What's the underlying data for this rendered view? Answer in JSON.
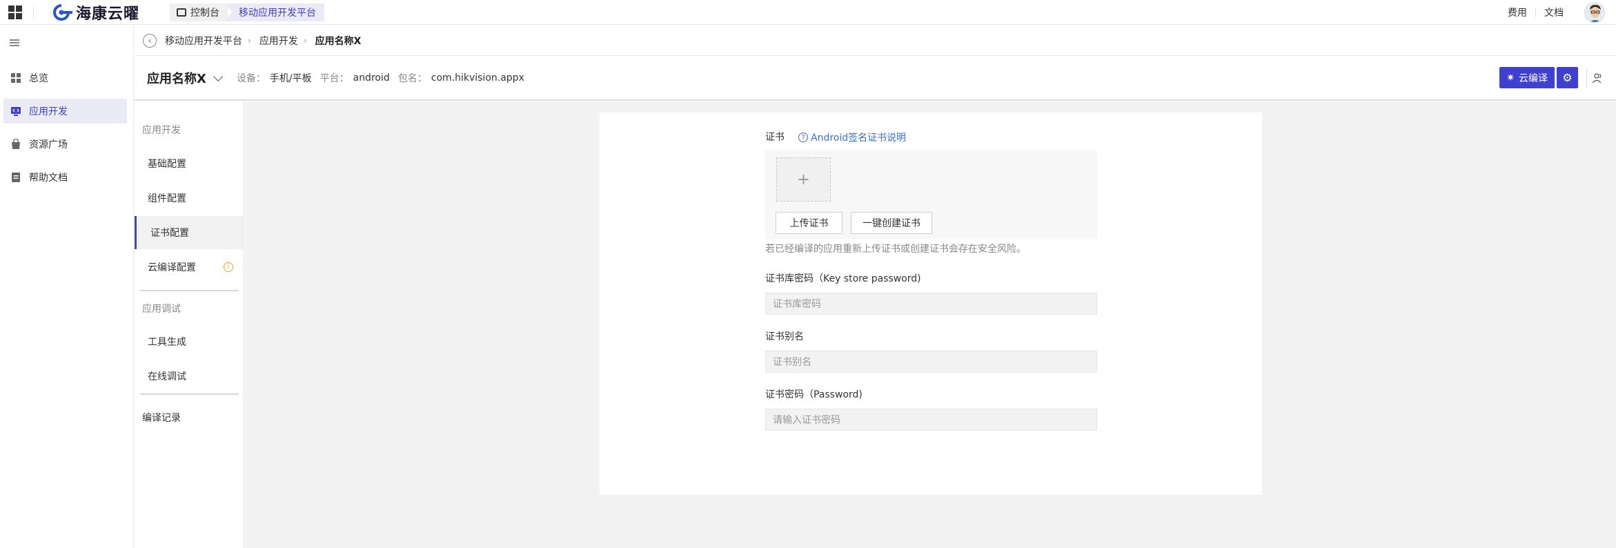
{
  "topbar": {
    "logo_text": "海康云曜",
    "crumbs": {
      "console": "控制台",
      "platform": "移动应用开发平台"
    },
    "links": {
      "fees": "费用",
      "docs": "文档"
    }
  },
  "sidebar": {
    "items": [
      {
        "label": "总览",
        "icon": "grid-icon"
      },
      {
        "label": "应用开发",
        "icon": "code-monitor-icon",
        "active": true
      },
      {
        "label": "资源广场",
        "icon": "bag-icon"
      },
      {
        "label": "帮助文档",
        "icon": "document-icon"
      }
    ]
  },
  "breadcrumb": {
    "items": [
      "移动应用开发平台",
      "应用开发",
      "应用名称X"
    ]
  },
  "app_header": {
    "name": "应用名称X",
    "device_label": "设备：",
    "device_value": "手机/平板",
    "platform_label": "平台：",
    "platform_value": "android",
    "package_label": "包名：",
    "package_value": "com.hikvision.appx",
    "build_button": "云编译"
  },
  "subnav": {
    "group_dev": "应用开发",
    "items_dev": [
      "基础配置",
      "组件配置",
      "证书配置",
      "云编译配置"
    ],
    "group_debug": "应用调试",
    "items_debug": [
      "工具生成",
      "在线调试"
    ],
    "build_log": "编译记录",
    "active_item": "证书配置"
  },
  "form": {
    "cert_label": "证书",
    "help_link": "Android签名证书说明",
    "upload_button": "上传证书",
    "create_button": "一键创建证书",
    "hint": "若已经编译的应用重新上传证书或创建证书会存在安全风险。",
    "keystore_label": "证书库密码（Key store password)",
    "keystore_placeholder": "证书库密码",
    "alias_label": "证书别名",
    "alias_placeholder": "证书别名",
    "password_label": "证书密码（Password)",
    "password_placeholder": "请输入证书密码"
  },
  "colors": {
    "accent": "#3f3fd0",
    "link": "#3f6fd0",
    "warning": "#f0a020"
  }
}
